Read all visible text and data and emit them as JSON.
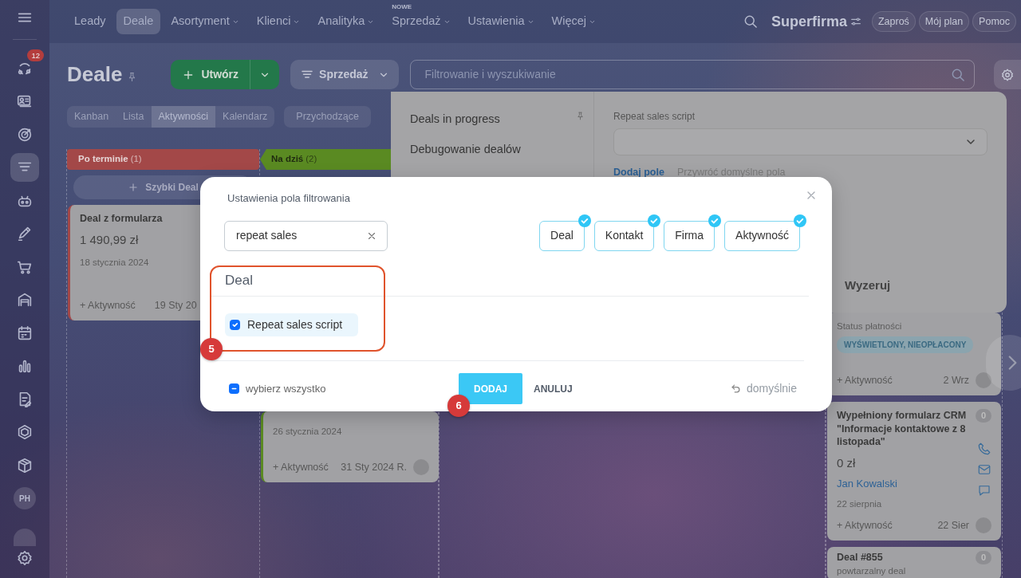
{
  "sidebar": {
    "items": [
      {
        "kind": "activity",
        "selected": false,
        "badge": "12"
      },
      {
        "kind": "contact",
        "selected": false
      },
      {
        "kind": "target",
        "selected": false
      },
      {
        "kind": "funnel",
        "selected": true
      },
      {
        "kind": "robot",
        "selected": false
      },
      {
        "kind": "pen",
        "selected": false
      },
      {
        "kind": "cart",
        "selected": false
      },
      {
        "kind": "warehouse",
        "selected": false
      },
      {
        "kind": "calendar",
        "selected": false
      },
      {
        "kind": "chart",
        "selected": false
      },
      {
        "kind": "document",
        "selected": false
      },
      {
        "kind": "hexagon",
        "selected": false
      },
      {
        "kind": "box",
        "selected": false
      },
      {
        "kind": "avatar",
        "selected": false,
        "initials": "PH"
      },
      {
        "kind": "avatar",
        "selected": false
      }
    ]
  },
  "topnav": {
    "items": [
      {
        "label": "Leady",
        "selected": false,
        "dropdown": false
      },
      {
        "label": "Deale",
        "selected": true,
        "dropdown": false
      },
      {
        "label": "Asortyment",
        "selected": false,
        "dropdown": true
      },
      {
        "label": "Klienci",
        "selected": false,
        "dropdown": true
      },
      {
        "label": "Analityka",
        "selected": false,
        "dropdown": true
      },
      {
        "label": "Sprzedaż",
        "selected": false,
        "dropdown": true,
        "tag": "NOWE"
      },
      {
        "label": "Ustawienia",
        "selected": false,
        "dropdown": true
      },
      {
        "label": "Więcej",
        "selected": false,
        "dropdown": true
      }
    ],
    "company": "Superfirma",
    "buttons": [
      "Zaproś",
      "Mój plan",
      "Pomoc"
    ]
  },
  "toolbar": {
    "title": "Deale",
    "create_button": "Utwórz",
    "pipeline_button": "Sprzedaż",
    "search": {
      "placeholder": "Filtrowanie i wyszukiwanie"
    }
  },
  "view_tabs": [
    {
      "label": "Kanban",
      "selected": false
    },
    {
      "label": "Lista",
      "selected": false
    },
    {
      "label": "Aktywności",
      "selected": true
    },
    {
      "label": "Kalendarz",
      "selected": false
    }
  ],
  "counter_filter": "Przychodzące",
  "kanban": {
    "columns": [
      {
        "title": "Po terminie",
        "count": "(1)",
        "color": "#a34848",
        "quick_add": "Szybki Deal",
        "cards": [
          {
            "title": "Deal z formularza",
            "amount": "1 490,99 zł",
            "date": "18 stycznia 2024",
            "activity": "+ Aktywność",
            "due": "19 Sty 20"
          }
        ]
      },
      {
        "title": "Na dziś",
        "count": "(2)",
        "color": "#5a8a22",
        "cards": [
          {
            "date": "26 stycznia 2024",
            "activity": "+ Aktywność",
            "due": "31 Sty 2024 R."
          }
        ]
      },
      {},
      {
        "cards": [
          {
            "field_label": "Status płatności",
            "field_badge": "WYŚWIETLONY, NIEOPŁACONY",
            "activity": "+ Aktywność",
            "due": "2 Wrz"
          },
          {
            "title": "Wypełniony formularz CRM \"Informacje kontaktowe z 8 listopada\"",
            "counter": "0",
            "amount": "0 zł",
            "contact": "Jan Kowalski",
            "date": "22 sierpnia",
            "activity": "+ Aktywność",
            "due": "22 Sier"
          },
          {
            "title": "Deal #855",
            "counter": "0",
            "subtitle": "powtarzalny deal"
          }
        ]
      }
    ]
  },
  "filter_popup": {
    "presets": [
      {
        "label": "Deals in progress",
        "pinned": true
      },
      {
        "label": "Debugowanie dealów",
        "pinned": false
      }
    ],
    "field": {
      "label": "Repeat sales script"
    },
    "add_field": "Dodaj pole",
    "restore_fields": "Przywróć domyślne pola",
    "reset_button": "Wyzeruj"
  },
  "modal": {
    "title": "Ustawienia pola filtrowania",
    "search": {
      "value": "repeat sales"
    },
    "entities": [
      {
        "label": "Deal",
        "checked": true
      },
      {
        "label": "Kontakt",
        "checked": true
      },
      {
        "label": "Firma",
        "checked": true
      },
      {
        "label": "Aktywność",
        "checked": true
      }
    ],
    "sections": [
      {
        "title": "Deal",
        "fields": [
          {
            "label": "Repeat sales script",
            "checked": true
          }
        ]
      }
    ],
    "select_all": {
      "label": "wybierz wszystko",
      "indeterminate": true
    },
    "add_button": "DODAJ",
    "cancel_button": "ANULUJ",
    "default_link": "domyślnie"
  },
  "annotations": [
    {
      "number": "5"
    },
    {
      "number": "6"
    }
  ]
}
